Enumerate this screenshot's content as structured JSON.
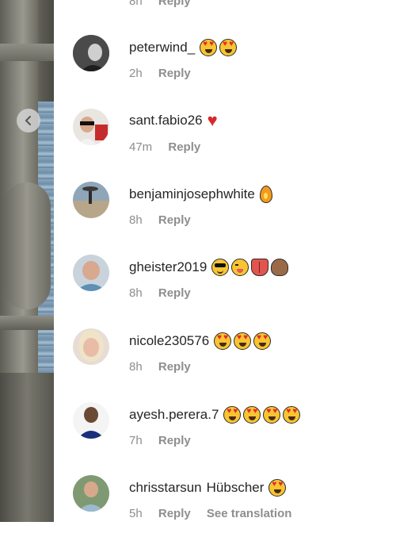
{
  "prev_comment": {
    "time": "8h",
    "reply": "Reply"
  },
  "comments": [
    {
      "username": "peterwind_",
      "time": "2h",
      "reply": "Reply",
      "emojis": [
        "heart-eyes",
        "heart-eyes"
      ]
    },
    {
      "username": "sant.fabio26",
      "time": "47m",
      "reply": "Reply",
      "emojis": [
        "red-heart"
      ]
    },
    {
      "username": "benjaminjosephwhite",
      "time": "8h",
      "reply": "Reply",
      "emojis": [
        "fire"
      ]
    },
    {
      "username": "gheister2019",
      "time": "8h",
      "reply": "Reply",
      "emojis": [
        "cool",
        "wink",
        "tongue",
        "peach"
      ]
    },
    {
      "username": "nicole230576",
      "time": "8h",
      "reply": "Reply",
      "emojis": [
        "heart-eyes",
        "heart-eyes",
        "heart-eyes"
      ]
    },
    {
      "username": "ayesh.perera.7",
      "time": "7h",
      "reply": "Reply",
      "emojis": [
        "heart-eyes",
        "heart-eyes",
        "heart-eyes",
        "heart-eyes"
      ]
    },
    {
      "username": "chrisstarsun",
      "text": "Hübscher",
      "time": "5h",
      "reply": "Reply",
      "translate": "See translation",
      "emojis": [
        "heart-eyes"
      ]
    }
  ],
  "colors": {
    "text": "#262626",
    "meta": "#8e8e8e",
    "heart": "#d62a2a"
  }
}
